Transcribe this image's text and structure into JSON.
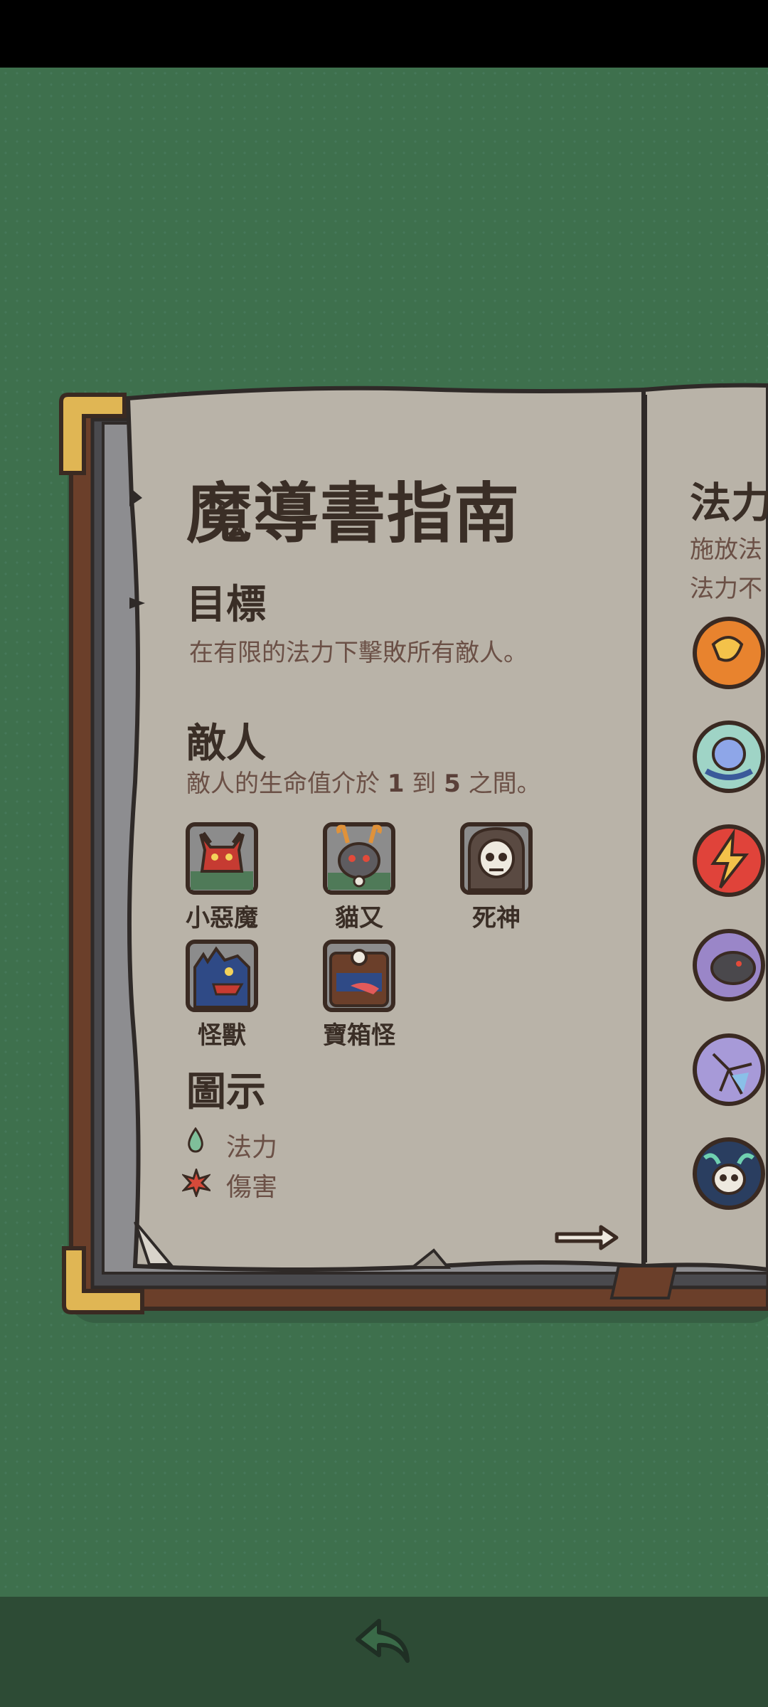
{
  "guide": {
    "title": "魔導書指南",
    "goal_heading": "目標",
    "goal_text": "在有限的法力下擊敗所有敵人。",
    "enemy_heading": "敵人",
    "enemy_text_prefix": "敵人的生命值介於 ",
    "enemy_min": "1",
    "enemy_mid": " 到 ",
    "enemy_max": "5",
    "enemy_text_suffix": " 之間。",
    "enemies": [
      {
        "name": "小惡魔",
        "icon": "imp-portrait-icon"
      },
      {
        "name": "貓又",
        "icon": "nekomata-portrait-icon"
      },
      {
        "name": "死神",
        "icon": "reaper-portrait-icon"
      },
      {
        "name": "怪獸",
        "icon": "monster-portrait-icon"
      },
      {
        "name": "寶箱怪",
        "icon": "mimic-portrait-icon"
      }
    ],
    "icons_heading": "圖示",
    "legend": [
      {
        "label": "法力",
        "icon": "mana-drop-icon"
      },
      {
        "label": "傷害",
        "icon": "damage-burst-icon"
      }
    ]
  },
  "right_page": {
    "title_partial": "法力",
    "line1_partial": "施放法",
    "line2_partial": "法力不",
    "spells": [
      "fireball-spell-icon",
      "wind-spell-icon",
      "lightning-spell-icon",
      "rat-spell-icon",
      "ice-spell-icon",
      "skull-spell-icon"
    ]
  },
  "colors": {
    "background": "#3e704d",
    "page": "#b9b3a8",
    "cover": "#6b3f2a",
    "ink": "#3a2e26"
  }
}
